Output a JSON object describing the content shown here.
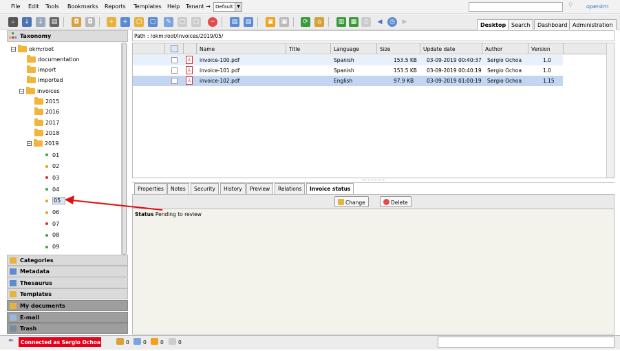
{
  "menu": {
    "items": [
      "File",
      "Edit",
      "Tools",
      "Bookmarks",
      "Reports",
      "Templates",
      "Help",
      "Tenant →"
    ],
    "tenant_value": "Default",
    "logo": "openkm"
  },
  "workspace_tabs": [
    "Desktop",
    "Search",
    "Dashboard",
    "Administration"
  ],
  "taxonomy": {
    "title": "Taxonomy",
    "tree": [
      {
        "label": "okm:root",
        "expander": "−",
        "type": "folder"
      },
      {
        "label": "documentation",
        "type": "folder"
      },
      {
        "label": "import",
        "type": "folder"
      },
      {
        "label": "imported",
        "type": "folder"
      },
      {
        "label": "invoices",
        "expander": "−",
        "type": "folder"
      },
      {
        "label": "2015",
        "type": "folder"
      },
      {
        "label": "2016",
        "type": "folder"
      },
      {
        "label": "2017",
        "type": "folder"
      },
      {
        "label": "2018",
        "type": "folder"
      },
      {
        "label": "2019",
        "expander": "−",
        "type": "folder"
      },
      {
        "label": "01",
        "type": "dot",
        "color": "#3aa53a"
      },
      {
        "label": "02",
        "type": "dot",
        "color": "#e5a019"
      },
      {
        "label": "03",
        "type": "dot",
        "color": "#d63030"
      },
      {
        "label": "04",
        "type": "dot",
        "color": "#3aa53a"
      },
      {
        "label": "05",
        "type": "dot",
        "color": "#e5a019",
        "selected": true
      },
      {
        "label": "06",
        "type": "dot",
        "color": "#e5a019"
      },
      {
        "label": "07",
        "type": "dot",
        "color": "#d63030"
      },
      {
        "label": "08",
        "type": "dot",
        "color": "#3aa53a"
      },
      {
        "label": "09",
        "type": "dot",
        "color": "#3aa53a"
      }
    ]
  },
  "accordion": [
    {
      "label": "Categories",
      "dark": false
    },
    {
      "label": "Metadata",
      "dark": false
    },
    {
      "label": "Thesaurus",
      "dark": false
    },
    {
      "label": "Templates",
      "dark": false
    },
    {
      "label": "My documents",
      "dark": true
    },
    {
      "label": "E-mail",
      "dark": true
    },
    {
      "label": "Trash",
      "dark": true
    }
  ],
  "path": "Path : /okm:root/invoices/2019/05/",
  "file_table": {
    "columns": [
      "Name",
      "Title",
      "Language",
      "Size",
      "Update date",
      "Author",
      "Version"
    ],
    "rows": [
      {
        "name": "invoice-100.pdf",
        "title": "",
        "language": "Spanish",
        "size": "153.5 KB",
        "date": "03-09-2019 00:40:37",
        "author": "Sergio Ochoa",
        "version": "1.0"
      },
      {
        "name": "invoice-101.pdf",
        "title": "",
        "language": "Spanish",
        "size": "153.5 KB",
        "date": "03-09-2019 00:40:19",
        "author": "Sergio Ochoa",
        "version": "1.0"
      },
      {
        "name": "invoice-102.pdf",
        "title": "",
        "language": "English",
        "size": "97.9 KB",
        "date": "03-09-2019 01:00:19",
        "author": "Sergio Ochoa",
        "version": "1.15",
        "selected": true
      }
    ]
  },
  "detail_tabs": [
    "Properties",
    "Notes",
    "Security",
    "History",
    "Preview",
    "Relations",
    "Invoice status"
  ],
  "actions": {
    "change": "Change",
    "delete": "Delete"
  },
  "status_panel": {
    "label": "Status",
    "value": "Pending to review"
  },
  "statusbar": {
    "connected": "Connected as Sergio Ochoa",
    "counts": [
      "0",
      "0",
      "0",
      "0"
    ]
  },
  "colors": {
    "selected_row": "#c2d5f2",
    "alt_row": "#e8f0fb",
    "connected_badge": "#e6001a"
  }
}
